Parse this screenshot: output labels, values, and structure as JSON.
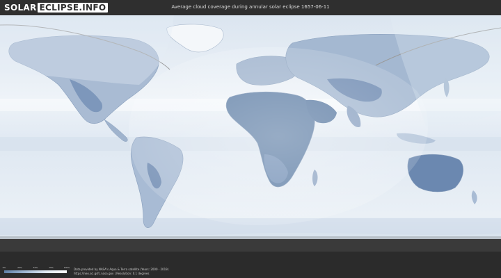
{
  "header": {
    "logo_left": "SOLAR",
    "logo_right": "ECLIPSE.INFO",
    "title": "Average cloud coverage during annular solar eclipse 1657-06-11"
  },
  "legend": {
    "ticks": [
      "0%",
      "25%",
      "50%",
      "75%",
      "100%"
    ],
    "low_color": "#5f7fa6",
    "high_color": "#ffffff"
  },
  "footer": {
    "credit_line1": "Data provided by NASA's Aqua & Terra satellite (Years: 2000 - 2019)",
    "credit_line2": "https://neo.sci.gsfc.nasa.gov | Resolution: 0.1 degrees"
  },
  "map": {
    "ocean_color": "#e7eef5",
    "land_color": "#7d97bb",
    "clear_sky_color": "#6680a8",
    "visibility_zone_color": "#f3f7fb",
    "path_line_color": "#9a9a9a"
  }
}
